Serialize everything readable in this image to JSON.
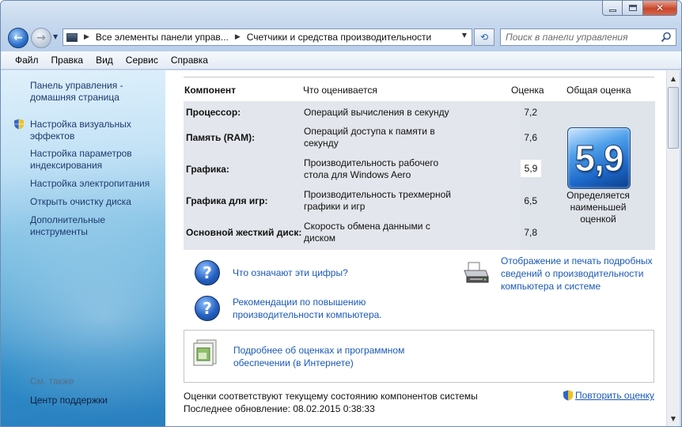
{
  "nav": {
    "back_icon": "arrow-left-icon",
    "forward_icon": "arrow-right-icon"
  },
  "address": {
    "segments": [
      "Все элементы панели управ...",
      "Счетчики и средства производительности"
    ]
  },
  "search": {
    "placeholder": "Поиск в панели управления"
  },
  "menu": [
    "Файл",
    "Правка",
    "Вид",
    "Сервис",
    "Справка"
  ],
  "sidebar": {
    "links": [
      "Панель управления - домашняя страница",
      "Настройка визуальных эффектов",
      "Настройка параметров индексирования",
      "Настройка электропитания",
      "Открыть очистку диска",
      "Дополнительные инструменты"
    ],
    "see_also_title": "См. также",
    "see_also": [
      "Центр поддержки"
    ]
  },
  "table": {
    "headers": {
      "component": "Компонент",
      "what": "Что оценивается",
      "score": "Оценка",
      "base": "Общая оценка"
    },
    "rows": [
      {
        "component": "Процессор:",
        "what": "Операций вычисления в секунду",
        "score": "7,2"
      },
      {
        "component": "Память (RAM):",
        "what": "Операций доступа к памяти в секунду",
        "score": "7,6"
      },
      {
        "component": "Графика:",
        "what": "Производительность рабочего стола для Windows Aero",
        "score": "5,9"
      },
      {
        "component": "Графика для игр:",
        "what": "Производительность трехмерной графики и игр",
        "score": "6,5"
      },
      {
        "component": "Основной жесткий диск:",
        "what": "Скорость обмена данными с диском",
        "score": "7,8"
      }
    ],
    "base_score": "5,9",
    "base_caption": "Определяется наименьшей оценкой"
  },
  "links": {
    "what_numbers": "Что означают эти цифры?",
    "tips": "Рекомендации по повышению производительности компьютера.",
    "print": "Отображение и печать подробных сведений о производительности компьютера и системе",
    "online": "Подробнее об оценках и программном обеспечении (в Интернете)"
  },
  "footer": {
    "status": "Оценки соответствуют текущему состоянию компонентов системы",
    "last_update": "Последнее обновление: 08.02.2015 0:38:33",
    "repeat": "Повторить оценку"
  }
}
